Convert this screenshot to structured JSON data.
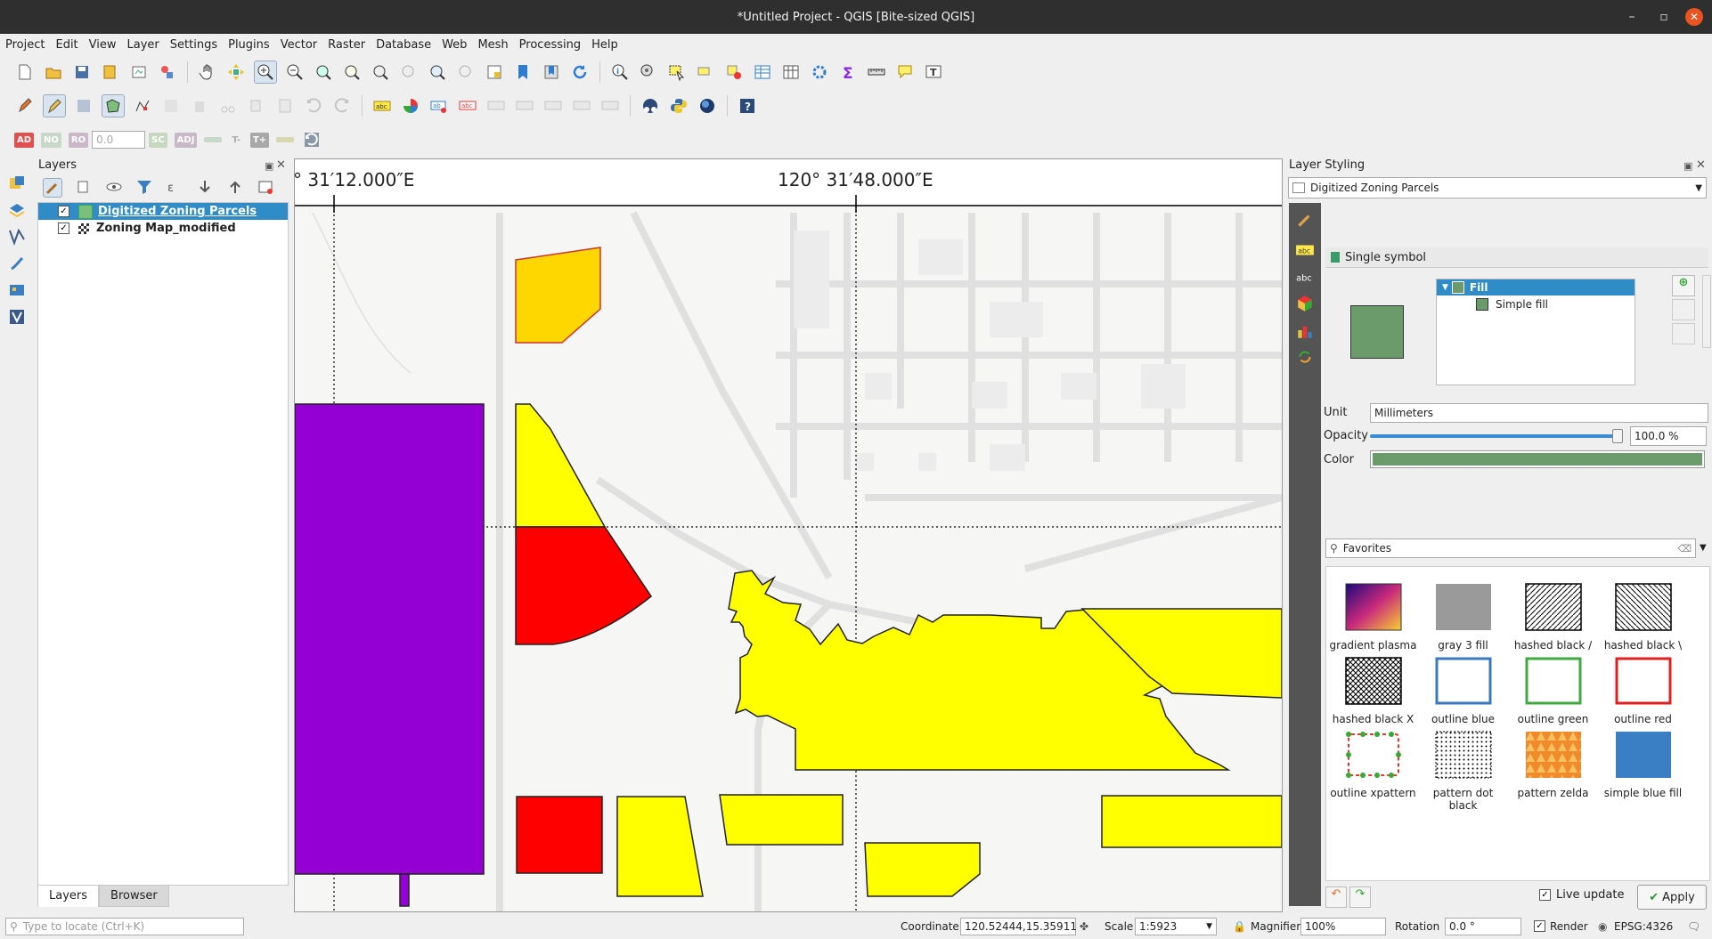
{
  "window": {
    "title": "*Untitled Project - QGIS [Bite-sized QGIS]"
  },
  "menu": [
    "Project",
    "Edit",
    "View",
    "Layer",
    "Settings",
    "Plugins",
    "Vector",
    "Raster",
    "Database",
    "Web",
    "Mesh",
    "Processing",
    "Help"
  ],
  "digitizing_toolbar": {
    "ad": "AD",
    "no": "NO",
    "ro": "RO",
    "value": "0.0",
    "sc": "SC",
    "adj": "ADJ",
    "t_minus": "T-",
    "t_plus": "T+"
  },
  "layers_panel": {
    "title": "Layers",
    "layers": [
      {
        "name": "Digitized Zoning Parcels",
        "checked": true,
        "selected": true,
        "icon": "polygon-layer-icon"
      },
      {
        "name": "Zoning Map_modified",
        "checked": true,
        "selected": false,
        "icon": "raster-layer-icon"
      }
    ],
    "tabs": [
      "Layers",
      "Browser"
    ]
  },
  "map": {
    "grid_label_left": "° 31′12.000″E",
    "grid_label_center": "120° 31′48.000″E",
    "colors": {
      "purple": "#9400d3",
      "yellow": "#ffff00",
      "gold": "#ffd700",
      "red": "#ff0000"
    }
  },
  "layer_styling": {
    "title": "Layer Styling",
    "layer": "Digitized Zoning Parcels",
    "renderer": "Single symbol",
    "tree": {
      "fill": "Fill",
      "simple_fill": "Simple fill"
    },
    "symbol_color": "#6b9a6b",
    "unit_label": "Unit",
    "unit": "Millimeters",
    "opacity_label": "Opacity",
    "opacity": "100.0 %",
    "opacity_fraction": 1.0,
    "color_label": "Color",
    "search": "Favorites",
    "symbols": [
      {
        "name": "gradient plasma",
        "kind": "gradient"
      },
      {
        "name": "gray 3 fill",
        "kind": "gray"
      },
      {
        "name": "hashed black /",
        "kind": "hash-fwd"
      },
      {
        "name": "hashed black \\",
        "kind": "hash-back"
      },
      {
        "name": "hashed black X",
        "kind": "hash-x"
      },
      {
        "name": "outline blue",
        "kind": "outline",
        "color": "#3a78c0"
      },
      {
        "name": "outline green",
        "kind": "outline",
        "color": "#3faa3f"
      },
      {
        "name": "outline red",
        "kind": "outline",
        "color": "#e02020"
      },
      {
        "name": "outline xpattern",
        "kind": "xpattern"
      },
      {
        "name": "pattern dot black",
        "kind": "dots"
      },
      {
        "name": "pattern zelda",
        "kind": "zelda"
      },
      {
        "name": "simple blue fill",
        "kind": "solid",
        "color": "#3a7fc4"
      }
    ],
    "live_update": "Live update",
    "apply": "Apply"
  },
  "statusbar": {
    "locate_placeholder": "Type to locate (Ctrl+K)",
    "coordinate_label": "Coordinate",
    "coordinate": "120.52444,15.35911",
    "scale_label": "Scale",
    "scale": "1:5923",
    "magnifier_label": "Magnifier",
    "magnifier": "100%",
    "rotation_label": "Rotation",
    "rotation": "0.0 °",
    "render": "Render",
    "crs": "EPSG:4326"
  }
}
